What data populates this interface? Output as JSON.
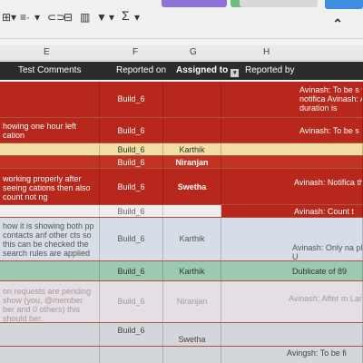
{
  "toolbar": {
    "items": [
      "⊞",
      "▾",
      "≡·",
      "▾",
      "⊂⊃",
      "⊟",
      "▥",
      "▼",
      "▾",
      "Σ",
      "▾"
    ],
    "collapse": "⌃"
  },
  "columns": {
    "e": "E",
    "f": "F",
    "g": "G",
    "h": "H"
  },
  "header": {
    "comments": "Test Comments",
    "reported_on": "Reported on",
    "assigned_to": "Assigned to",
    "reported_by": "Reported by"
  },
  "rows": [
    {
      "e": "",
      "f": "Build_6",
      "g": "",
      "h": "Avinash: To be s time this notifica Avinash: As per c when duration is"
    },
    {
      "e": "howing one hour left cation",
      "f": "Build_6",
      "g": "",
      "h": "Avinash: To be s"
    },
    {
      "e": "",
      "f": "Build_6",
      "g": "Karthik",
      "h": ""
    },
    {
      "e": "",
      "f": "Build_6",
      "g": "Niranjan",
      "h": ""
    },
    {
      "e": "working properly after seeing cations then also count not ng",
      "f": "Build_6",
      "g": "Swetha",
      "h": "Avinash: Notifica this api in Home"
    },
    {
      "e": "",
      "f": "Build_6",
      "g": "",
      "h": "Avinash: Count t"
    },
    {
      "e": "how it is showing both pp contacts anf other cts so this can be checked the search rules are applied",
      "f": "Build_6",
      "g": "Karthik",
      "h": "Avinash: Only na please add the U"
    },
    {
      "e": "",
      "f": "Build_6",
      "g": "Karthik",
      "h": "Dublicate of 89"
    },
    {
      "e": "on requests are pending show (you, @member ber and 0 others) this should ber.",
      "f": "Build_6",
      "g": "Niranjan",
      "h": "Avinash: After m Langour: Modifie"
    },
    {
      "e": "",
      "f": "Build_6",
      "g": "Swetha",
      "h": ""
    },
    {
      "e": "",
      "f": "",
      "g": "",
      "h": "Avingsh: To be fi"
    }
  ]
}
